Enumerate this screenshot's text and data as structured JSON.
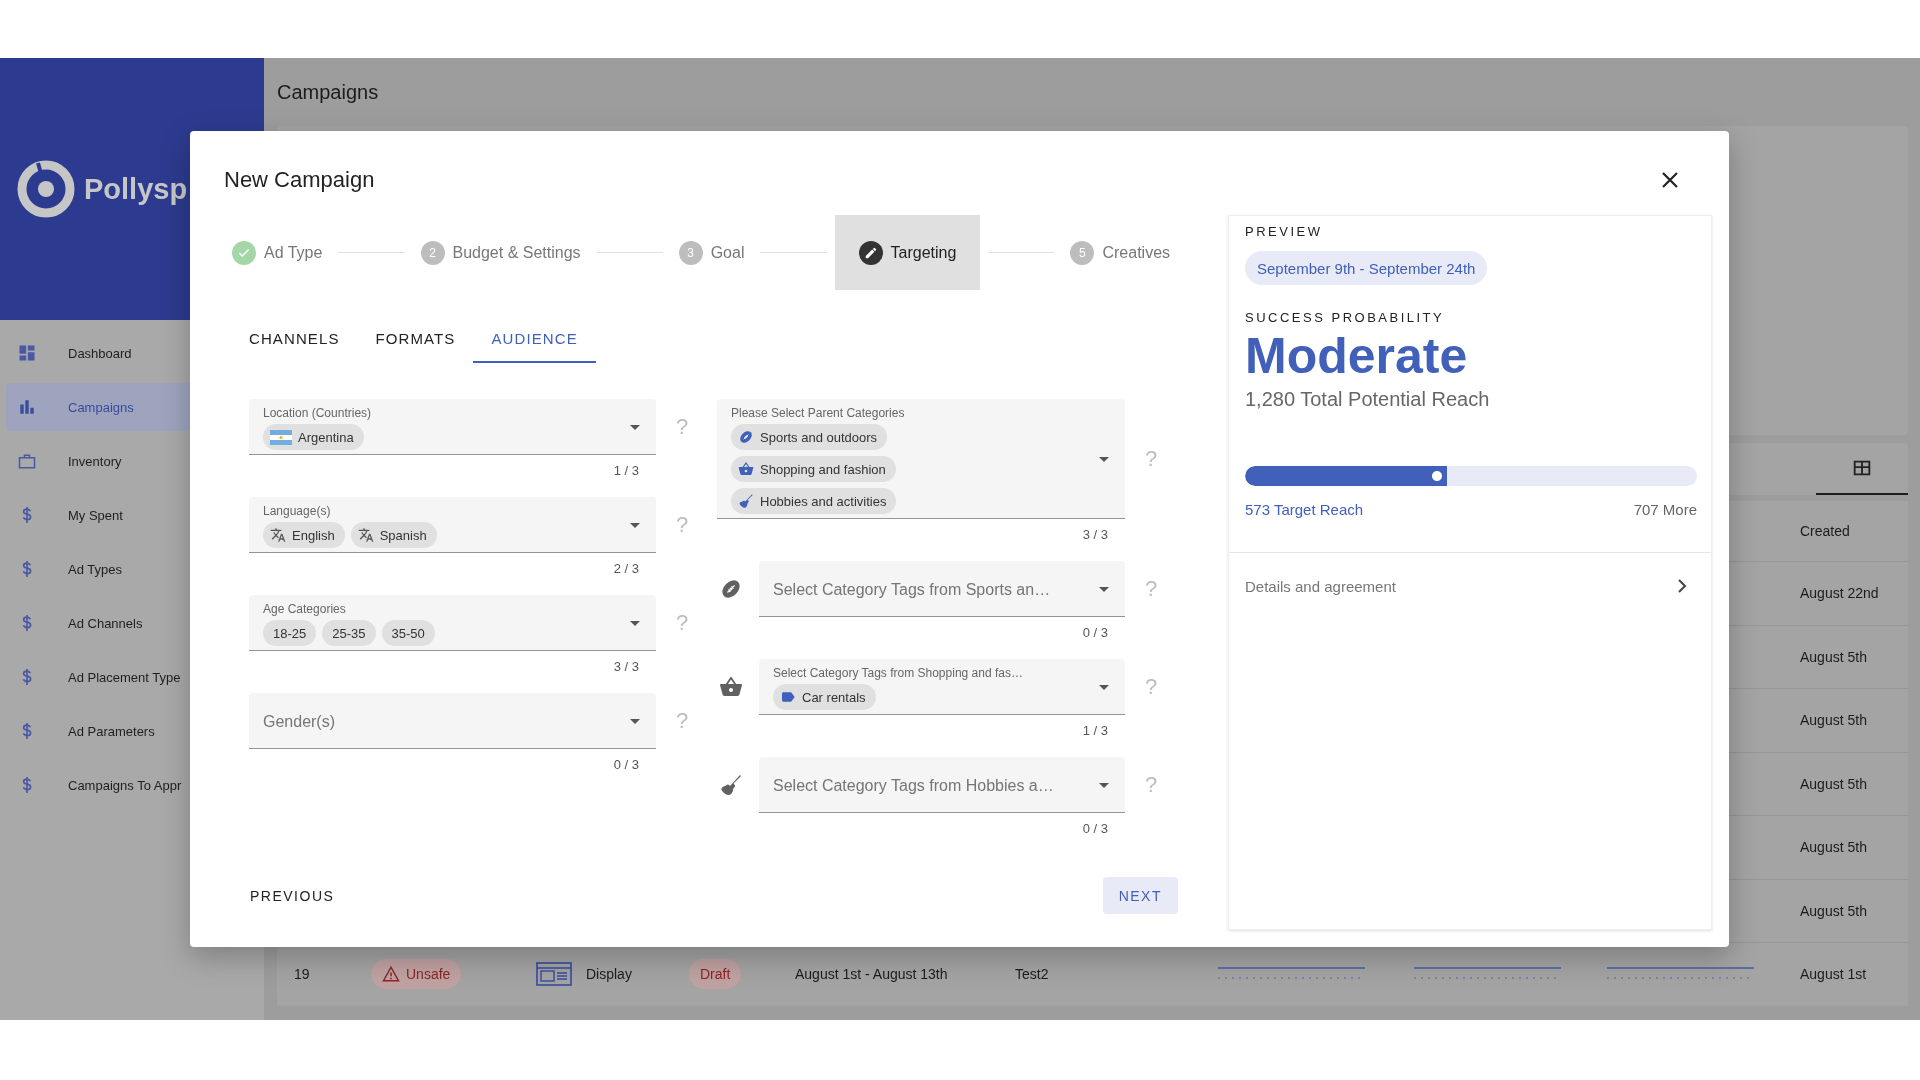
{
  "sidebar": {
    "logo_text": "Pollysp",
    "items": [
      {
        "label": "Dashboard",
        "kind": "dashboard",
        "selected": false
      },
      {
        "label": "Campaigns",
        "kind": "chart",
        "selected": true
      },
      {
        "label": "Inventory",
        "kind": "inventory",
        "selected": false
      },
      {
        "label": "My Spent",
        "kind": "money",
        "selected": false
      },
      {
        "label": "Ad Types",
        "kind": "money",
        "selected": false
      },
      {
        "label": "Ad Channels",
        "kind": "money",
        "selected": false
      },
      {
        "label": "Ad Placement Type",
        "kind": "money",
        "selected": false
      },
      {
        "label": "Ad Parameters",
        "kind": "money",
        "selected": false
      },
      {
        "label": "Campaigns To Appr",
        "kind": "money",
        "selected": false
      }
    ]
  },
  "page": {
    "title": "Campaigns",
    "table": {
      "created_header": "Created",
      "rows": [
        {
          "created": "August 22nd"
        },
        {
          "created": "August 5th"
        },
        {
          "created": "August 5th"
        },
        {
          "created": "August 5th"
        },
        {
          "created": "August 5th"
        },
        {
          "created": "August 5th"
        },
        {
          "id": "19",
          "safety": "Unsafe",
          "type": "Display",
          "status": "Draft",
          "dates": "August 1st - August 13th",
          "name": "Test2",
          "created": "August 1st"
        }
      ]
    }
  },
  "dialog": {
    "title": "New Campaign",
    "steps": [
      {
        "label": "Ad Type",
        "completed": true,
        "selected": false
      },
      {
        "label": "Budget & Settings",
        "number": "2",
        "completed": false,
        "selected": false
      },
      {
        "label": "Goal",
        "number": "3",
        "completed": false,
        "selected": false
      },
      {
        "label": "Targeting",
        "completed": false,
        "selected": true
      },
      {
        "label": "Creatives",
        "number": "5",
        "completed": false,
        "selected": false
      }
    ],
    "tabs": [
      {
        "label": "CHANNELS",
        "selected": false
      },
      {
        "label": "FORMATS",
        "selected": false
      },
      {
        "label": "AUDIENCE",
        "selected": true
      }
    ],
    "left_fields": [
      {
        "label": "Location (Countries)",
        "chips": [
          {
            "label": "Argentina",
            "kind": "country"
          }
        ],
        "counter": "1 / 3",
        "help": "?"
      },
      {
        "label": "Language(s)",
        "chips": [
          {
            "label": "English",
            "kind": "language"
          },
          {
            "label": "Spanish",
            "kind": "language"
          }
        ],
        "counter": "2 / 3",
        "help": "?"
      },
      {
        "label": "Age Categories",
        "chips": [
          {
            "label": "18-25",
            "kind": "plain"
          },
          {
            "label": "25-35",
            "kind": "plain"
          },
          {
            "label": "35-50",
            "kind": "plain"
          }
        ],
        "counter": "3 / 3",
        "help": "?"
      },
      {
        "label": "Gender(s)",
        "counter": "0 / 3",
        "help": "?"
      }
    ],
    "parent_categories": {
      "label": "Please Select Parent Categories",
      "chips": [
        {
          "label": "Sports and outdoors",
          "kind": "sports"
        },
        {
          "label": "Shopping and fashion",
          "kind": "shopping"
        },
        {
          "label": "Hobbies and activities",
          "kind": "hobbies"
        }
      ],
      "counter": "3 / 3",
      "help": "?"
    },
    "tag_fields": [
      {
        "kind": "sports",
        "label": "Select Category Tags from Sports an…",
        "counter": "0 / 3",
        "help": "?"
      },
      {
        "kind": "shopping",
        "label": "Select Category Tags from Shopping and fas…",
        "chips": [
          {
            "label": "Car rentals",
            "kind": "tag"
          }
        ],
        "counter": "1 / 3",
        "help": "?"
      },
      {
        "kind": "hobbies",
        "label": "Select Category Tags from Hobbies a…",
        "counter": "0 / 3",
        "help": "?"
      }
    ],
    "previous_button": "PREVIOUS",
    "next_button": "NEXT"
  },
  "preview": {
    "heading": "PREVIEW",
    "dates": "September 9th - September 24th",
    "probability_label": "SUCCESS PROBABILITY",
    "probability": "Moderate",
    "total_reach": "1,280 Total Potential Reach",
    "reach": {
      "level": 0.447
    },
    "target_reach": "573 Target Reach",
    "more": "707 More",
    "details": "Details and agreement"
  }
}
